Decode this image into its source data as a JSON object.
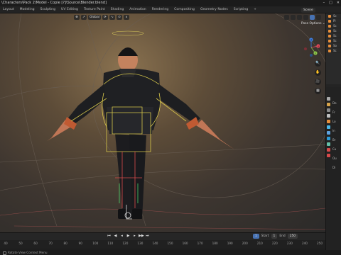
{
  "titlebar": {
    "title": "\\Characters\\Pack 2\\Model - Copie [?]\\Source\\Blender.blend]",
    "controls": [
      "–",
      "□",
      "✕"
    ]
  },
  "workspace_tabs": [
    {
      "label": "Layout",
      "active": false
    },
    {
      "label": "Modeling",
      "active": false
    },
    {
      "label": "Sculpting",
      "active": false
    },
    {
      "label": "UV Editing",
      "active": false
    },
    {
      "label": "Texture Paint",
      "active": false
    },
    {
      "label": "Shading",
      "active": false
    },
    {
      "label": "Animation",
      "active": false
    },
    {
      "label": "Rendering",
      "active": false
    },
    {
      "label": "Compositing",
      "active": false
    },
    {
      "label": "Geometry Nodes",
      "active": false
    },
    {
      "label": "Scripting",
      "active": false
    },
    {
      "label": "+",
      "active": false
    }
  ],
  "scene": {
    "label": "Scene"
  },
  "viewport": {
    "tool_labels": [
      "⊕",
      "↗",
      "Global",
      "⟳",
      "∿",
      "⊙",
      "∧"
    ],
    "pose_options": "Pose Options ⌄",
    "gizmo_axes": [
      {
        "name": "X",
        "color": "#e94a5c"
      },
      {
        "name": "Y",
        "color": "#8bc34a"
      },
      {
        "name": "Z",
        "color": "#3f7fe0"
      }
    ],
    "nav_icons": [
      "🔍",
      "✋",
      "🎥",
      "▦"
    ]
  },
  "timeline": {
    "play_controls": [
      "⏮",
      "◀",
      "◂",
      "▶",
      "▸",
      "▶▶",
      "⏭"
    ],
    "current_frame": "1",
    "start_label": "Start",
    "start_value": "1",
    "end_label": "End",
    "end_value": "250",
    "ruler_ticks": [
      "40",
      "50",
      "60",
      "70",
      "80",
      "90",
      "100",
      "110",
      "120",
      "130",
      "140",
      "150",
      "160",
      "170",
      "180",
      "190",
      "200",
      "210",
      "220",
      "230",
      "240",
      "250"
    ]
  },
  "status": {
    "text": "Rotate View  Context Menu"
  },
  "outliner": {
    "items": [
      "Sc",
      "Pl",
      "Sc",
      "Sc",
      "Sc",
      "Sc",
      "So",
      "Sc"
    ]
  },
  "properties": {
    "rows": [
      "Do",
      "Fr",
      "Lo",
      "In",
      "Br",
      "Cu",
      "Ou",
      "Di"
    ],
    "tab_colors": [
      "#aaaaaa",
      "#d8a44a",
      "#8a8a8a",
      "#c0c0c0",
      "#e98f3a",
      "#4bb8e8",
      "#5ea3e0",
      "#2a9bd8",
      "#65c0a8",
      "#d84a4a",
      "#d84a4a"
    ]
  }
}
